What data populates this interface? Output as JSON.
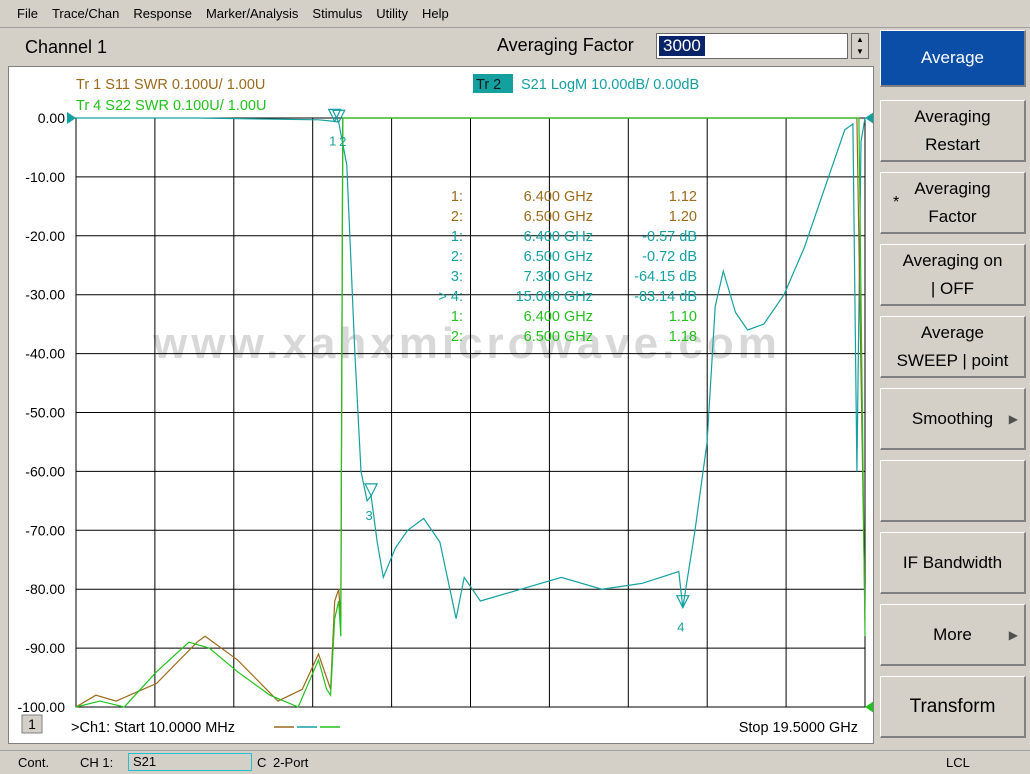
{
  "menu": [
    "File",
    "Trace/Chan",
    "Response",
    "Marker/Analysis",
    "Stimulus",
    "Utility",
    "Help"
  ],
  "channel": {
    "title": "Channel 1",
    "entry_label": "Averaging Factor",
    "entry_value": "3000"
  },
  "colors": {
    "trace1": "#9b6a1a",
    "trace2": "#15a0a0",
    "trace4": "#22c21c",
    "active_key": "#0a4ea8"
  },
  "traces": [
    {
      "id": "tr1",
      "label": "Tr  1   S11 SWR 0.100U/  1.00U",
      "color": "#9b6a1a"
    },
    {
      "id": "tr4",
      "label": "Tr  4   S22 SWR 0.100U/  1.00U",
      "color": "#22c21c"
    },
    {
      "id": "tr2",
      "tag": "Tr  2",
      "label": "S21 LogM 10.00dB/  0.00dB",
      "color": "#15a0a0"
    }
  ],
  "markers": [
    {
      "idx": "1:",
      "freq": "6.400 GHz",
      "val": "1.12",
      "color": "#9b6a1a"
    },
    {
      "idx": "2:",
      "freq": "6.500 GHz",
      "val": "1.20",
      "color": "#9b6a1a"
    },
    {
      "idx": "1:",
      "freq": "6.400 GHz",
      "val": "-0.57 dB",
      "color": "#15a0a0"
    },
    {
      "idx": "2:",
      "freq": "6.500 GHz",
      "val": "-0.72 dB",
      "color": "#15a0a0"
    },
    {
      "idx": "3:",
      "freq": "7.300 GHz",
      "val": "-64.15 dB",
      "color": "#15a0a0"
    },
    {
      "idx": "> 4:",
      "freq": "15.000 GHz",
      "val": "-83.14 dB",
      "color": "#15a0a0"
    },
    {
      "idx": "1:",
      "freq": "6.400 GHz",
      "val": "1.10",
      "color": "#22c21c"
    },
    {
      "idx": "2:",
      "freq": "6.500 GHz",
      "val": "1.18",
      "color": "#22c21c"
    }
  ],
  "watermark": "www.xahxmicrowave.com",
  "footer": {
    "channel_num": "1",
    "start": ">Ch1: Start  10.0000 MHz",
    "stop": "Stop  19.5000 GHz"
  },
  "softkeys": [
    {
      "label": "Average",
      "active": true
    },
    {
      "label": "Averaging Restart"
    },
    {
      "label": "Averaging Factor",
      "mark": "*"
    },
    {
      "label": "Averaging on | OFF"
    },
    {
      "label": "Average SWEEP | point"
    },
    {
      "label": "Smoothing",
      "submenu": "▶"
    },
    {
      "label": ""
    },
    {
      "label": "IF Bandwidth"
    },
    {
      "label": "More",
      "submenu": "▶"
    },
    {
      "label": "Transform"
    }
  ],
  "status": {
    "mode": "Cont.",
    "channel": "CH 1:",
    "measurement": "S21",
    "cal": "C",
    "port": "2-Port",
    "remote": "LCL"
  },
  "chart_data": {
    "type": "line",
    "xlim": [
      0.01,
      19.5
    ],
    "ylim": [
      -100,
      0
    ],
    "ytick_labels": [
      "0.00",
      "-10.00",
      "-20.00",
      "-30.00",
      "-40.00",
      "-50.00",
      "-60.00",
      "-70.00",
      "-80.00",
      "-90.00",
      "-100.00"
    ],
    "grid": true,
    "series": [
      {
        "name": "S21",
        "color": "#15a0a0",
        "x": [
          0.01,
          3.0,
          6.0,
          6.4,
          6.5,
          6.7,
          6.9,
          7.05,
          7.2,
          7.3,
          7.45,
          7.6,
          7.9,
          8.2,
          8.6,
          9.0,
          9.4,
          9.6,
          10.0,
          11.0,
          12.0,
          13.0,
          14.0,
          14.9,
          15.0,
          15.3,
          15.6,
          15.8,
          16.0,
          16.3,
          16.6,
          17.0,
          17.5,
          18.0,
          18.5,
          19.0,
          19.2,
          19.3,
          19.4,
          19.5
        ],
        "y": [
          0,
          0,
          -0.3,
          -0.57,
          -0.72,
          -8,
          -40,
          -60,
          -65,
          -64.15,
          -72,
          -78,
          -73,
          -70,
          -68,
          -72,
          -85,
          -78,
          -82,
          -80,
          -78,
          -80,
          -79,
          -77,
          -83.14,
          -70,
          -55,
          -32,
          -26,
          -33,
          -36,
          -35,
          -30,
          -22,
          -12,
          -2,
          -1,
          -60,
          -4,
          0
        ]
      },
      {
        "name": "S11",
        "color": "#9b6a1a",
        "x": [
          0.01,
          0.5,
          1.0,
          2.0,
          3.0,
          3.2,
          4.0,
          5.0,
          5.6,
          6.0,
          6.2,
          6.3,
          6.4,
          6.5,
          6.55,
          6.6,
          19.3,
          19.5
        ],
        "y": [
          -100,
          -98,
          -99,
          -96,
          -89,
          -88,
          -92,
          -99,
          -97,
          -91,
          -95,
          -97,
          -82,
          -80,
          -85,
          0,
          0,
          -85
        ]
      },
      {
        "name": "S22",
        "color": "#22c21c",
        "x": [
          0.01,
          0.6,
          1.2,
          2.0,
          2.8,
          3.3,
          4.0,
          4.8,
          5.5,
          6.0,
          6.2,
          6.3,
          6.4,
          6.5,
          6.55,
          6.6,
          19.35,
          19.5
        ],
        "y": [
          -100,
          -99,
          -100,
          -94,
          -89,
          -90,
          -94,
          -98,
          -100,
          -92,
          -97,
          -98,
          -85,
          -82,
          -88,
          0,
          0,
          -88
        ]
      }
    ],
    "markers": [
      {
        "trace": "S21",
        "id": "1",
        "x": 6.4,
        "y": -0.57
      },
      {
        "trace": "S21",
        "id": "2",
        "x": 6.5,
        "y": -0.72
      },
      {
        "trace": "S21",
        "id": "3",
        "x": 7.3,
        "y": -64.15
      },
      {
        "trace": "S21",
        "id": "4",
        "x": 15.0,
        "y": -83.14
      }
    ]
  }
}
